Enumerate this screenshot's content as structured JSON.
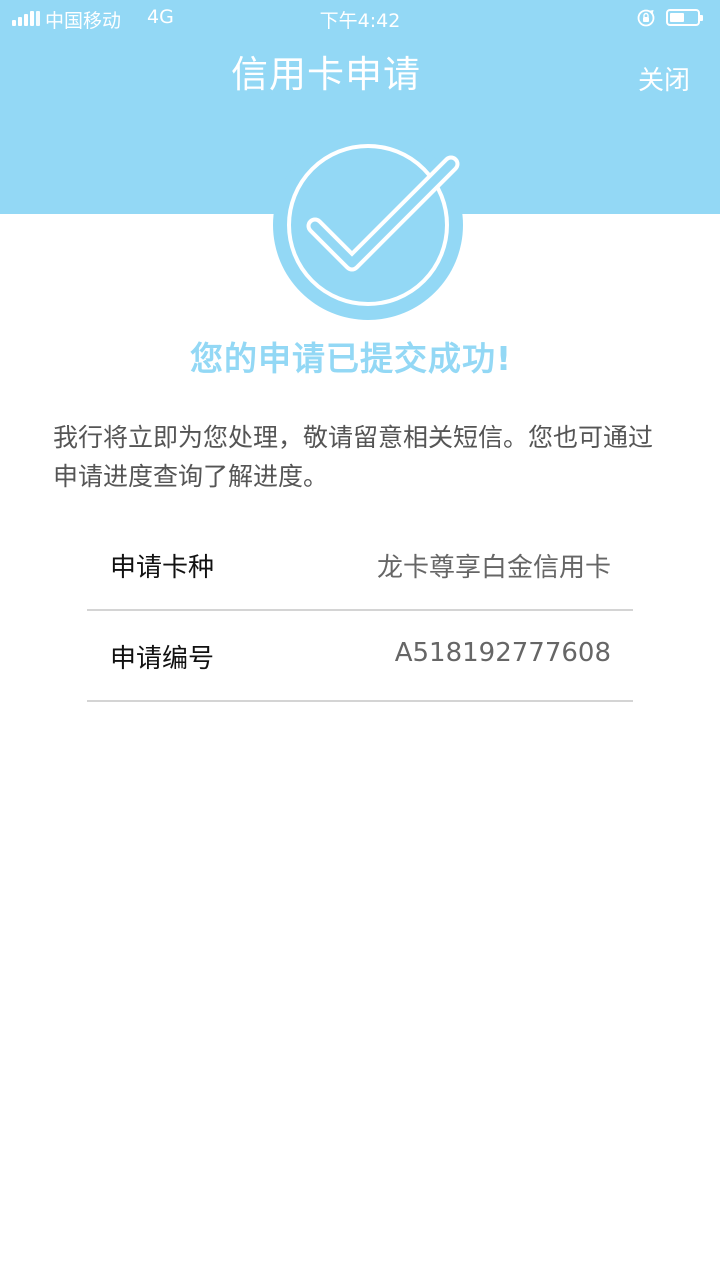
{
  "status_bar": {
    "carrier": "中国移动",
    "network": "4G",
    "time": "下午4:42",
    "battery_level": 0.55
  },
  "nav": {
    "title": "信用卡申请",
    "close_label": "关闭"
  },
  "result": {
    "title": "您的申请已提交成功!",
    "description": "我行将立即为您处理，敬请留意相关短信。您也可通过申请进度查询了解进度。"
  },
  "details": [
    {
      "label": "申请卡种",
      "value": "龙卡尊享白金信用卡"
    },
    {
      "label": "申请编号",
      "value": "A518192777608"
    }
  ],
  "colors": {
    "accent": "#93d8f5",
    "divider": "#d4d4d4"
  },
  "icons": {
    "signal": "signal-icon",
    "lock": "rotation-lock-icon",
    "battery": "battery-icon",
    "check": "checkmark-circle-icon"
  }
}
